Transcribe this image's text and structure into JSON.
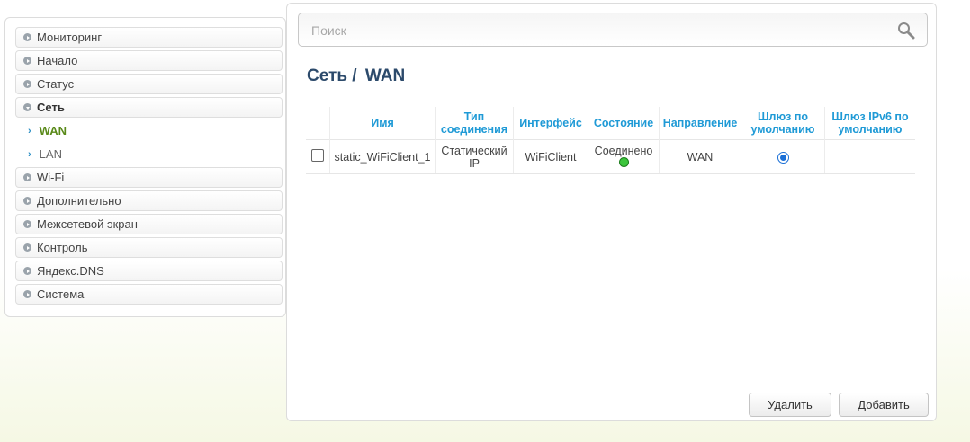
{
  "sidebar": {
    "items": [
      {
        "label": "Мониторинг"
      },
      {
        "label": "Начало"
      },
      {
        "label": "Статус"
      },
      {
        "label": "Сеть"
      },
      {
        "label": "WAN"
      },
      {
        "label": "LAN"
      },
      {
        "label": "Wi-Fi"
      },
      {
        "label": "Дополнительно"
      },
      {
        "label": "Межсетевой экран"
      },
      {
        "label": "Контроль"
      },
      {
        "label": "Яндекс.DNS"
      },
      {
        "label": "Система"
      }
    ]
  },
  "search": {
    "placeholder": "Поиск"
  },
  "page": {
    "title_prefix": "Сеть /",
    "title": "WAN"
  },
  "table": {
    "headers": [
      "Имя",
      "Тип соединения",
      "Интерфейс",
      "Состояние",
      "Направление",
      "Шлюз по умолчанию",
      "Шлюз IPv6 по умолчанию"
    ],
    "rows": [
      {
        "name": "static_WiFiClient_1",
        "type": "Статический IP",
        "interface": "WiFiClient",
        "state": "Соединено",
        "direction": "WAN",
        "default_gw": true,
        "default_gw6": false
      }
    ]
  },
  "buttons": {
    "delete": "Удалить",
    "add": "Добавить"
  },
  "colors": {
    "accent": "#1f9ad6",
    "title": "#2c4a6b",
    "active_menu": "#5a8a1a",
    "status_ok": "#3cc53c"
  }
}
